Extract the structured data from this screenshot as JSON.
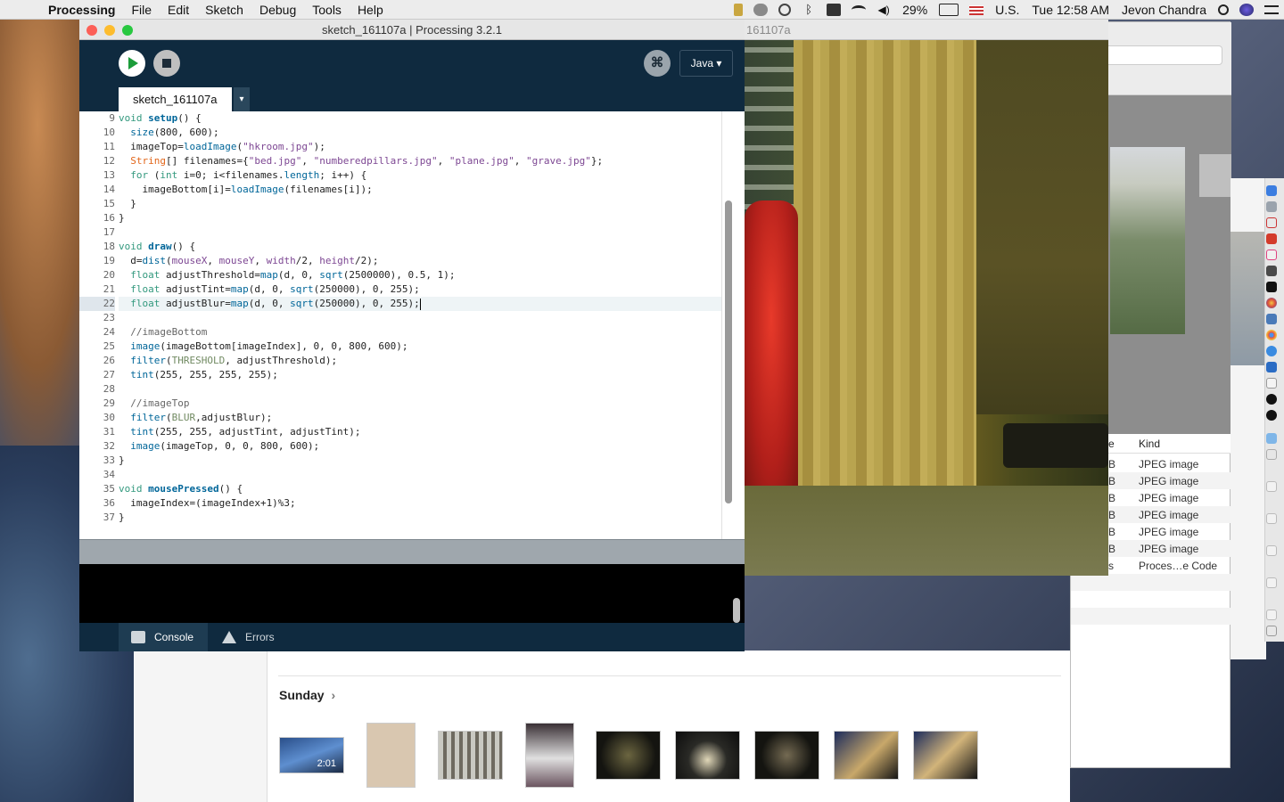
{
  "menubar": {
    "app": "Processing",
    "items": [
      "File",
      "Edit",
      "Sketch",
      "Debug",
      "Tools",
      "Help"
    ],
    "battery": "29%",
    "input_source": "U.S.",
    "clock": "Tue 12:58 AM",
    "user": "Jevon Chandra"
  },
  "ide": {
    "window_title": "sketch_161107a | Processing 3.2.1",
    "mode": "Java ▾",
    "tab_name": "sketch_161107a",
    "tab_menu": "▾",
    "debug_glyph": "⌘",
    "console_tabs": [
      "Console",
      "Errors"
    ],
    "code_lines": [
      {
        "num": "9"
      },
      {
        "num": "10"
      },
      {
        "num": "11"
      },
      {
        "num": "12"
      },
      {
        "num": "13"
      },
      {
        "num": "14"
      },
      {
        "num": "15"
      },
      {
        "num": "16"
      },
      {
        "num": "17"
      },
      {
        "num": "18"
      },
      {
        "num": "19"
      },
      {
        "num": "20"
      },
      {
        "num": "21"
      },
      {
        "num": "22"
      },
      {
        "num": "23"
      },
      {
        "num": "24"
      },
      {
        "num": "25"
      },
      {
        "num": "26"
      },
      {
        "num": "27"
      },
      {
        "num": "28"
      },
      {
        "num": "29"
      },
      {
        "num": "30"
      },
      {
        "num": "31"
      },
      {
        "num": "32"
      },
      {
        "num": "33"
      },
      {
        "num": "34"
      },
      {
        "num": "35"
      },
      {
        "num": "36"
      },
      {
        "num": "37"
      }
    ],
    "code": {
      "l9": [
        "void",
        " ",
        "setup",
        "() {"
      ],
      "l10": [
        "  ",
        "size",
        "(800, 600);"
      ],
      "l11": [
        "  imageTop=",
        "loadImage",
        "(",
        "\"hkroom.jpg\"",
        ");"
      ],
      "l12": [
        "  ",
        "String",
        "[] filenames={",
        "\"bed.jpg\"",
        ", ",
        "\"numberedpillars.jpg\"",
        ", ",
        "\"plane.jpg\"",
        ", ",
        "\"grave.jpg\"",
        "};"
      ],
      "l13": [
        "  ",
        "for",
        " (",
        "int",
        " i=0; i<filenames.",
        "length",
        "; i++) {"
      ],
      "l14": [
        "    imageBottom[i]=",
        "loadImage",
        "(filenames[i]);"
      ],
      "l15": [
        "  }"
      ],
      "l16": [
        "}"
      ],
      "l17": [
        ""
      ],
      "l18": [
        "void",
        " ",
        "draw",
        "() {"
      ],
      "l19": [
        "  d=",
        "dist",
        "(",
        "mouseX",
        ", ",
        "mouseY",
        ", ",
        "width",
        "/2, ",
        "height",
        "/2);"
      ],
      "l20": [
        "  ",
        "float",
        " adjustThreshold=",
        "map",
        "(d, 0, ",
        "sqrt",
        "(2500000), 0.5, 1);"
      ],
      "l21": [
        "  ",
        "float",
        " adjustTint=",
        "map",
        "(d, 0, ",
        "sqrt",
        "(250000), 0, 255);"
      ],
      "l22": [
        "  ",
        "float",
        " adjustBlur=",
        "map",
        "(d, 0, ",
        "sqrt",
        "(250000), 0, 255);"
      ],
      "l23": [
        ""
      ],
      "l24": [
        "  //imageBottom"
      ],
      "l25": [
        "  ",
        "image",
        "(imageBottom[imageIndex], 0, 0, 800, 600);"
      ],
      "l26": [
        "  ",
        "filter",
        "(",
        "THRESHOLD",
        ", adjustThreshold);"
      ],
      "l27": [
        "  ",
        "tint",
        "(255, 255, 255, 255);"
      ],
      "l28": [
        ""
      ],
      "l29": [
        "  //imageTop"
      ],
      "l30": [
        "  ",
        "filter",
        "(",
        "BLUR",
        ",adjustBlur);"
      ],
      "l31": [
        "  ",
        "tint",
        "(255, 255, adjustTint, adjustTint);"
      ],
      "l32": [
        "  ",
        "image",
        "(imageTop, 0, 0, 800, 600);"
      ],
      "l33": [
        "}"
      ],
      "l34": [
        ""
      ],
      "l35": [
        "void",
        " ",
        "mousePressed",
        "() {"
      ],
      "l36": [
        "  imageIndex=(imageIndex+1)%3;"
      ],
      "l37": [
        "}"
      ]
    }
  },
  "sketch_window": {
    "title": "161107a"
  },
  "photos": {
    "day_label": "Sunday",
    "chevron": "›",
    "video_duration": "2:01"
  },
  "finder": {
    "col_e": "e",
    "col_kind": "Kind",
    "rows": [
      {
        "b": "B",
        "kind": "JPEG image"
      },
      {
        "b": "B",
        "kind": "JPEG image"
      },
      {
        "b": "B",
        "kind": "JPEG image"
      },
      {
        "b": "B",
        "kind": "JPEG image"
      },
      {
        "b": "B",
        "kind": "JPEG image"
      },
      {
        "b": "B",
        "kind": "JPEG image"
      },
      {
        "b": "s",
        "kind": "Proces…e Code"
      }
    ]
  },
  "colors": {
    "ide_bg": "#0f2a3f",
    "run_green": "#1b9c3a",
    "close_red": "#fc5f57",
    "min_yellow": "#fdbc2e",
    "max_green": "#28c840"
  }
}
